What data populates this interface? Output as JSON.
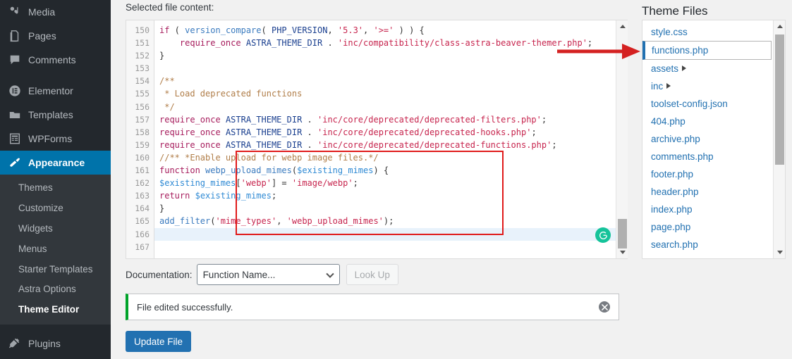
{
  "sidebar": {
    "items": [
      {
        "label": "Media",
        "icon": "media-icon",
        "current": false
      },
      {
        "label": "Pages",
        "icon": "pages-icon",
        "current": false
      },
      {
        "label": "Comments",
        "icon": "comments-icon",
        "current": false
      },
      {
        "label": "Elementor",
        "icon": "elementor-icon",
        "current": false
      },
      {
        "label": "Templates",
        "icon": "templates-icon",
        "current": false
      },
      {
        "label": "WPForms",
        "icon": "wpforms-icon",
        "current": false
      },
      {
        "label": "Appearance",
        "icon": "appearance-icon",
        "current": true
      },
      {
        "label": "Plugins",
        "icon": "plugins-icon",
        "current": false
      }
    ],
    "submenu": [
      {
        "label": "Themes",
        "active": false
      },
      {
        "label": "Customize",
        "active": false
      },
      {
        "label": "Widgets",
        "active": false
      },
      {
        "label": "Menus",
        "active": false
      },
      {
        "label": "Starter Templates",
        "active": false
      },
      {
        "label": "Astra Options",
        "active": false
      },
      {
        "label": "Theme Editor",
        "active": true
      }
    ],
    "accent_current": "#0073aa",
    "background": "#23282d",
    "submenu_background": "#32373c"
  },
  "editor": {
    "heading": "Selected file content:",
    "first_line_number": 150,
    "highlighted_line": 166,
    "annotation_box_lines": [
      160,
      166
    ],
    "lines": [
      {
        "n": 150,
        "tokens": [
          {
            "t": "if",
            "c": "t-kw"
          },
          {
            "t": " ( ",
            "c": "t-pl"
          },
          {
            "t": "version_compare",
            "c": "t-fn"
          },
          {
            "t": "( ",
            "c": "t-pl"
          },
          {
            "t": "PHP_VERSION",
            "c": "t-cst"
          },
          {
            "t": ", ",
            "c": "t-pl"
          },
          {
            "t": "'5.3'",
            "c": "t-str"
          },
          {
            "t": ", ",
            "c": "t-pl"
          },
          {
            "t": "'>='",
            "c": "t-str"
          },
          {
            "t": " ) ) {",
            "c": "t-pl"
          }
        ]
      },
      {
        "n": 151,
        "tokens": [
          {
            "t": "    ",
            "c": "t-pl"
          },
          {
            "t": "require_once",
            "c": "t-kw"
          },
          {
            "t": " ",
            "c": "t-pl"
          },
          {
            "t": "ASTRA_THEME_DIR",
            "c": "t-cst"
          },
          {
            "t": " . ",
            "c": "t-pl"
          },
          {
            "t": "'inc/compatibility/class-astra-beaver-themer.php'",
            "c": "t-str"
          },
          {
            "t": ";",
            "c": "t-pl"
          }
        ]
      },
      {
        "n": 152,
        "tokens": [
          {
            "t": "}",
            "c": "t-pl"
          }
        ]
      },
      {
        "n": 153,
        "tokens": []
      },
      {
        "n": 154,
        "tokens": [
          {
            "t": "/**",
            "c": "t-cmt"
          }
        ]
      },
      {
        "n": 155,
        "tokens": [
          {
            "t": " * Load deprecated functions",
            "c": "t-cmt"
          }
        ]
      },
      {
        "n": 156,
        "tokens": [
          {
            "t": " */",
            "c": "t-cmt"
          }
        ]
      },
      {
        "n": 157,
        "tokens": [
          {
            "t": "require_once",
            "c": "t-kw"
          },
          {
            "t": " ",
            "c": "t-pl"
          },
          {
            "t": "ASTRA_THEME_DIR",
            "c": "t-cst"
          },
          {
            "t": " . ",
            "c": "t-pl"
          },
          {
            "t": "'inc/core/deprecated/deprecated-filters.php'",
            "c": "t-str"
          },
          {
            "t": ";",
            "c": "t-pl"
          }
        ]
      },
      {
        "n": 158,
        "tokens": [
          {
            "t": "require_once",
            "c": "t-kw"
          },
          {
            "t": " ",
            "c": "t-pl"
          },
          {
            "t": "ASTRA_THEME_DIR",
            "c": "t-cst"
          },
          {
            "t": " . ",
            "c": "t-pl"
          },
          {
            "t": "'inc/core/deprecated/deprecated-hooks.php'",
            "c": "t-str"
          },
          {
            "t": ";",
            "c": "t-pl"
          }
        ]
      },
      {
        "n": 159,
        "tokens": [
          {
            "t": "require_once",
            "c": "t-kw"
          },
          {
            "t": " ",
            "c": "t-pl"
          },
          {
            "t": "ASTRA_THEME_DIR",
            "c": "t-cst"
          },
          {
            "t": " . ",
            "c": "t-pl"
          },
          {
            "t": "'inc/core/deprecated/deprecated-functions.php'",
            "c": "t-str"
          },
          {
            "t": ";",
            "c": "t-pl"
          }
        ]
      },
      {
        "n": 160,
        "tokens": [
          {
            "t": "//** *Enable upload for webp image files.*/",
            "c": "t-cmt"
          }
        ]
      },
      {
        "n": 161,
        "tokens": [
          {
            "t": "function",
            "c": "t-kw"
          },
          {
            "t": " ",
            "c": "t-pl"
          },
          {
            "t": "webp_upload_mimes",
            "c": "t-fn"
          },
          {
            "t": "(",
            "c": "t-pl"
          },
          {
            "t": "$existing_mimes",
            "c": "t-var"
          },
          {
            "t": ") {",
            "c": "t-pl"
          }
        ]
      },
      {
        "n": 162,
        "tokens": [
          {
            "t": "$existing_mimes",
            "c": "t-var"
          },
          {
            "t": "[",
            "c": "t-pl"
          },
          {
            "t": "'webp'",
            "c": "t-str"
          },
          {
            "t": "] = ",
            "c": "t-pl"
          },
          {
            "t": "'image/webp'",
            "c": "t-str"
          },
          {
            "t": ";",
            "c": "t-pl"
          }
        ]
      },
      {
        "n": 163,
        "tokens": [
          {
            "t": "return",
            "c": "t-kw"
          },
          {
            "t": " ",
            "c": "t-pl"
          },
          {
            "t": "$existing_mimes",
            "c": "t-var"
          },
          {
            "t": ";",
            "c": "t-pl"
          }
        ]
      },
      {
        "n": 164,
        "tokens": [
          {
            "t": "}",
            "c": "t-pl"
          }
        ]
      },
      {
        "n": 165,
        "tokens": [
          {
            "t": "add_filter",
            "c": "t-fn"
          },
          {
            "t": "(",
            "c": "t-pl"
          },
          {
            "t": "'mime_types'",
            "c": "t-str"
          },
          {
            "t": ", ",
            "c": "t-pl"
          },
          {
            "t": "'webp_upload_mimes'",
            "c": "t-str"
          },
          {
            "t": ");",
            "c": "t-pl"
          }
        ]
      },
      {
        "n": 166,
        "tokens": []
      },
      {
        "n": 167,
        "tokens": []
      }
    ]
  },
  "documentation": {
    "label": "Documentation:",
    "selected": "Function Name...",
    "options": [
      "Function Name..."
    ],
    "lookup_label": "Look Up",
    "lookup_disabled": true
  },
  "notice": {
    "message": "File edited successfully.",
    "type": "success",
    "accent": "#00a32a",
    "dismiss_label": "✕"
  },
  "update": {
    "label": "Update File",
    "color": "#2271b1"
  },
  "theme_files": {
    "title": "Theme Files",
    "items": [
      {
        "label": "style.css",
        "selected": false,
        "folder": false
      },
      {
        "label": "functions.php",
        "selected": true,
        "folder": false
      },
      {
        "label": "assets",
        "selected": false,
        "folder": true
      },
      {
        "label": "inc",
        "selected": false,
        "folder": true
      },
      {
        "label": "toolset-config.json",
        "selected": false,
        "folder": false
      },
      {
        "label": "404.php",
        "selected": false,
        "folder": false
      },
      {
        "label": "archive.php",
        "selected": false,
        "folder": false
      },
      {
        "label": "comments.php",
        "selected": false,
        "folder": false
      },
      {
        "label": "footer.php",
        "selected": false,
        "folder": false
      },
      {
        "label": "header.php",
        "selected": false,
        "folder": false
      },
      {
        "label": "index.php",
        "selected": false,
        "folder": false
      },
      {
        "label": "page.php",
        "selected": false,
        "folder": false
      },
      {
        "label": "search.php",
        "selected": false,
        "folder": false
      }
    ],
    "link_color": "#2271b1"
  },
  "annotations": {
    "arrow_color": "#d42121",
    "box_color": "#e01b1b"
  },
  "grammarly": {
    "color": "#15c39a",
    "glyph": "G"
  }
}
